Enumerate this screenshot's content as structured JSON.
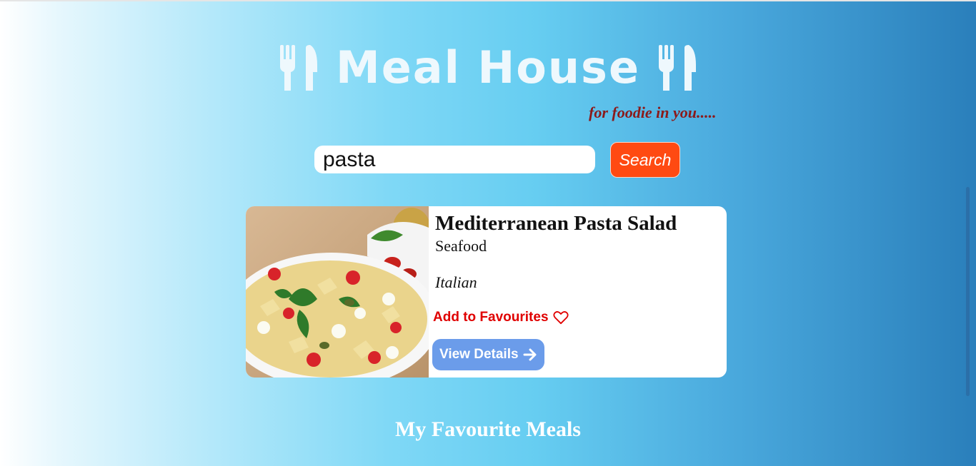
{
  "header": {
    "title": "Meal House",
    "tagline": "for foodie in you.....",
    "icon_left": "fork-knife-icon",
    "icon_right": "fork-knife-icon"
  },
  "search": {
    "value": "pasta",
    "button_label": "Search"
  },
  "meal": {
    "name": "Mediterranean Pasta Salad",
    "category": "Seafood",
    "area": "Italian",
    "favourite_label": "Add to Favourites",
    "favourite_icon": "heart-outline-icon",
    "details_label": "View Details",
    "details_icon": "arrow-right-icon",
    "image": "pasta-salad-photo"
  },
  "favourites": {
    "heading": "My Favourite Meals"
  },
  "colors": {
    "search_button": "#ff4a12",
    "tagline": "#8b1a1a",
    "favourite_link": "#e00000",
    "details_button": "#6b9cea"
  }
}
